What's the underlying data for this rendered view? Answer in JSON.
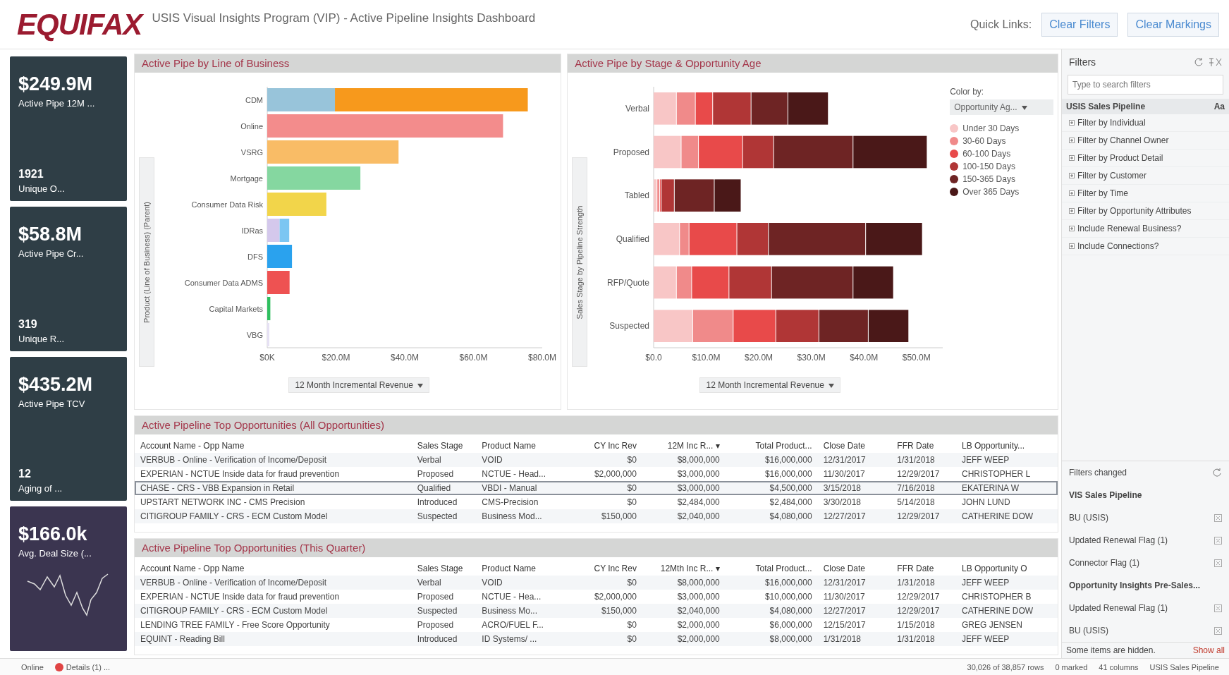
{
  "header": {
    "logo": "EQUIFAX",
    "title": "USIS Visual Insights Program (VIP) - Active Pipeline Insights Dashboard",
    "quick_links_label": "Quick Links:",
    "buttons": [
      "Clear Filters",
      "Clear Markings"
    ]
  },
  "kpis": [
    {
      "kind": "split",
      "value": "$249.9M",
      "label": "Active Pipe 12M ...",
      "sub_value": "1921",
      "sub_label": "Unique O..."
    },
    {
      "kind": "split",
      "value": "$58.8M",
      "label": "Active Pipe Cr...",
      "sub_value": "319",
      "sub_label": "Unique R..."
    },
    {
      "kind": "split",
      "value": "$435.2M",
      "label": "Active Pipe TCV",
      "sub_value": "12",
      "sub_label": "Aging of ..."
    },
    {
      "kind": "trend",
      "value": "$166.0k",
      "label": "Avg. Deal Size (..."
    }
  ],
  "charts": [
    {
      "title": "Active Pipe by Line of Business",
      "y_axis_label": "Product (Line of Business) (Parent)",
      "x_selector": "12 Month Incremental Revenue",
      "chart_data": {
        "type": "bar",
        "orientation": "horizontal",
        "stacked": true,
        "categories": [
          "CDM",
          "Online",
          "VSRG",
          "Mortgage",
          "Consumer Data Risk",
          "IDRas",
          "DFS",
          "Consumer Data ADMS",
          "Capital Markets",
          "VBG"
        ],
        "series": [
          {
            "values": [
              19.7,
              68.6,
              38.2,
              27.1,
              17.2,
              3.6,
              7.2,
              6.5,
              0.9,
              0.6
            ],
            "colors": [
              "#98c4da",
              "#f38c8c",
              "#f9bc66",
              "#85d7a0",
              "#f2d54a",
              "#d4c8ec",
              "#2aa2ee",
              "#ee5252",
              "#2fbf5f",
              "#e6e0f4"
            ]
          },
          {
            "values": [
              56.1,
              null,
              null,
              null,
              null,
              2.8,
              null,
              null,
              null,
              null
            ],
            "colors": [
              "#f7991c",
              null,
              null,
              null,
              null,
              "#7cc6f2",
              null,
              null,
              null,
              null
            ]
          }
        ],
        "xlim": [
          0,
          80
        ],
        "xticks": [
          {
            "value": 0,
            "label": "$0K"
          },
          {
            "value": 20,
            "label": "$20.0M"
          },
          {
            "value": 40,
            "label": "$40.0M"
          },
          {
            "value": 60,
            "label": "$60.0M"
          },
          {
            "value": 80,
            "label": "$80.0M"
          }
        ]
      }
    },
    {
      "title": "Active Pipe by Stage & Opportunity Age",
      "y_axis_label": "Sales Stage by Pipeline Strength",
      "x_selector": "12 Month Incremental Revenue",
      "color_by_label": "Color by:",
      "color_by_value": "Opportunity Ag...",
      "chart_data": {
        "type": "bar",
        "orientation": "horizontal",
        "stacked": true,
        "categories": [
          "Verbal",
          "Proposed",
          "Tabled",
          "Qualified",
          "RFP/Quote",
          "Suspected"
        ],
        "series": [
          {
            "name": "Under 30 Days",
            "color": "#f8c6c6",
            "values": [
              4.4,
              5.3,
              0.7,
              5.0,
              4.4,
              7.5
            ]
          },
          {
            "name": "30-60 Days",
            "color": "#f08a8a",
            "values": [
              3.6,
              3.3,
              0.5,
              1.8,
              2.9,
              7.7
            ]
          },
          {
            "name": "60-100 Days",
            "color": "#e84a4a",
            "values": [
              3.3,
              8.4,
              0.3,
              9.1,
              7.1,
              8.1
            ]
          },
          {
            "name": "100-150 Days",
            "color": "#b03636",
            "values": [
              7.3,
              5.9,
              2.5,
              6.0,
              8.1,
              8.2
            ]
          },
          {
            "name": "150-365 Days",
            "color": "#6e2424",
            "values": [
              7.0,
              15.1,
              7.6,
              18.5,
              15.5,
              9.4
            ]
          },
          {
            "name": "Over 365 Days",
            "color": "#4a1818",
            "values": [
              7.7,
              14.1,
              5.1,
              10.8,
              7.7,
              7.7
            ]
          }
        ],
        "xlim": [
          0,
          55
        ],
        "xticks": [
          {
            "value": 0,
            "label": "$0.0"
          },
          {
            "value": 10,
            "label": "$10.0M"
          },
          {
            "value": 20,
            "label": "$20.0M"
          },
          {
            "value": 30,
            "label": "$30.0M"
          },
          {
            "value": 40,
            "label": "$40.0M"
          },
          {
            "value": 50,
            "label": "$50.0M"
          }
        ]
      }
    }
  ],
  "tables": [
    {
      "title": "Active Pipeline Top Opportunities (All Opportunities)",
      "columns": [
        {
          "label": "Account Name - Opp Name",
          "kind": "text"
        },
        {
          "label": "Sales Stage",
          "kind": "text"
        },
        {
          "label": "Product Name",
          "kind": "text"
        },
        {
          "label": "CY Inc Rev",
          "kind": "number"
        },
        {
          "label": "12M Inc R... ▾",
          "kind": "number"
        },
        {
          "label": "Total Product...",
          "kind": "number"
        },
        {
          "label": "Close Date",
          "kind": "text"
        },
        {
          "label": "FFR Date",
          "kind": "text"
        },
        {
          "label": "LB Opportunity...",
          "kind": "text"
        }
      ],
      "rows": [
        {
          "selected": false,
          "cells": [
            "VERBUB - Online - Verification of Income/Deposit",
            "Verbal",
            "VOID",
            "$0",
            "$8,000,000",
            "$16,000,000",
            "12/31/2017",
            "1/31/2018",
            "JEFF WEEP"
          ]
        },
        {
          "selected": false,
          "cells": [
            "EXPERIAN - NCTUE Inside data for fraud prevention",
            "Proposed",
            "NCTUE - Head...",
            "$2,000,000",
            "$3,000,000",
            "$16,000,000",
            "11/30/2017",
            "12/29/2017",
            "CHRISTOPHER L"
          ]
        },
        {
          "selected": true,
          "cells": [
            "CHASE - CRS - VBB Expansion in Retail",
            "Qualified",
            "VBDI - Manual",
            "$0",
            "$3,000,000",
            "$4,500,000",
            "3/15/2018",
            "7/16/2018",
            "EKATERINA W"
          ]
        },
        {
          "selected": false,
          "cells": [
            "UPSTART NETWORK INC - CMS Precision",
            "Introduced",
            "CMS-Precision",
            "$0",
            "$2,484,000",
            "$2,484,000",
            "3/30/2018",
            "5/14/2018",
            "JOHN LUND"
          ]
        },
        {
          "selected": false,
          "cells": [
            "CITIGROUP FAMILY - CRS - ECM Custom Model",
            "Suspected",
            "Business Mod...",
            "$150,000",
            "$2,040,000",
            "$4,080,000",
            "12/27/2017",
            "12/29/2017",
            "CATHERINE DOW"
          ]
        }
      ]
    },
    {
      "title": "Active Pipeline Top Opportunities (This Quarter)",
      "columns": [
        {
          "label": "Account Name - Opp Name",
          "kind": "text"
        },
        {
          "label": "Sales Stage",
          "kind": "text"
        },
        {
          "label": "Product Name",
          "kind": "text"
        },
        {
          "label": "CY Inc Rev",
          "kind": "number"
        },
        {
          "label": "12Mth Inc R... ▾",
          "kind": "number"
        },
        {
          "label": "Total Product...",
          "kind": "number"
        },
        {
          "label": "Close Date",
          "kind": "text"
        },
        {
          "label": "FFR Date",
          "kind": "text"
        },
        {
          "label": "LB Opportunity O",
          "kind": "text"
        }
      ],
      "rows": [
        {
          "selected": false,
          "cells": [
            "VERBUB - Online - Verification of Income/Deposit",
            "Verbal",
            "VOID",
            "$0",
            "$8,000,000",
            "$16,000,000",
            "12/31/2017",
            "1/31/2018",
            "JEFF WEEP"
          ]
        },
        {
          "selected": false,
          "cells": [
            "EXPERIAN - NCTUE Inside data for fraud prevention",
            "Proposed",
            "NCTUE - Hea...",
            "$2,000,000",
            "$3,000,000",
            "$10,000,000",
            "11/30/2017",
            "12/29/2017",
            "CHRISTOPHER B"
          ]
        },
        {
          "selected": false,
          "cells": [
            "CITIGROUP FAMILY - CRS - ECM Custom Model",
            "Suspected",
            "Business Mo...",
            "$150,000",
            "$2,040,000",
            "$4,080,000",
            "12/27/2017",
            "12/29/2017",
            "CATHERINE DOW"
          ]
        },
        {
          "selected": false,
          "cells": [
            "LENDING TREE FAMILY - Free Score Opportunity",
            "Proposed",
            "ACRO/FUEL F...",
            "$0",
            "$2,000,000",
            "$6,000,000",
            "12/15/2017",
            "1/15/2018",
            "GREG JENSEN"
          ]
        },
        {
          "selected": false,
          "cells": [
            "EQUINT - Reading Bill",
            "Introduced",
            "ID Systems/ ...",
            "$0",
            "$2,000,000",
            "$8,000,000",
            "1/31/2018",
            "1/31/2018",
            "JEFF WEEP"
          ]
        }
      ]
    }
  ],
  "filters": {
    "title": "Filters",
    "search": {
      "placeholder": "Type to search filters"
    },
    "group": "USIS Sales Pipeline",
    "group_icon": "Aa",
    "items": [
      {
        "label": "Filter by Individual"
      },
      {
        "label": "Filter by Channel Owner"
      },
      {
        "label": "Filter by Product Detail"
      },
      {
        "label": "Filter by Customer"
      },
      {
        "label": "Filter by Time"
      },
      {
        "label": "Filter by Opportunity Attributes"
      },
      {
        "label": "Include Renewal Business?"
      },
      {
        "label": "Include Connections?"
      }
    ],
    "in_use": {
      "title": "Filters changed",
      "items": [
        {
          "kind": "group",
          "label": "VIS Sales Pipeline"
        },
        {
          "kind": "item",
          "label": "BU (USIS)"
        },
        {
          "kind": "item",
          "label": "Updated Renewal Flag (1)"
        },
        {
          "kind": "item",
          "label": "Connector Flag (1)"
        },
        {
          "kind": "group",
          "label": "Opportunity Insights Pre-Sales..."
        },
        {
          "kind": "item",
          "label": "Updated Renewal Flag (1)"
        },
        {
          "kind": "item",
          "label": "BU (USIS)"
        }
      ],
      "hidden_note": "Some items are hidden.",
      "show_link": "Show all"
    }
  },
  "status_bar": {
    "online": "Online",
    "details": "Details (1) ...",
    "rows": "30,026 of 38,857 rows",
    "marked": "0 marked",
    "columns": "41 columns",
    "table": "USIS Sales Pipeline"
  }
}
